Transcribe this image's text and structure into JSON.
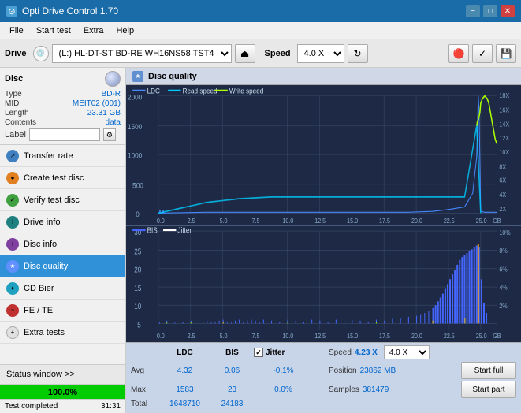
{
  "titlebar": {
    "title": "Opti Drive Control 1.70",
    "icon": "⊙",
    "minimize": "−",
    "maximize": "□",
    "close": "✕"
  },
  "menu": {
    "items": [
      "File",
      "Start test",
      "Extra",
      "Help"
    ]
  },
  "toolbar": {
    "drive_label": "Drive",
    "drive_value": "(L:)  HL-DT-ST BD-RE  WH16NS58 TST4",
    "speed_label": "Speed",
    "speed_value": "4.0 X"
  },
  "sidebar": {
    "disc_title": "Disc",
    "disc_type_label": "Type",
    "disc_type_value": "BD-R",
    "disc_mid_label": "MID",
    "disc_mid_value": "MEIT02 (001)",
    "disc_length_label": "Length",
    "disc_length_value": "23.31 GB",
    "disc_contents_label": "Contents",
    "disc_contents_value": "data",
    "disc_label_label": "Label",
    "nav_items": [
      {
        "id": "transfer-rate",
        "label": "Transfer rate",
        "icon": "↗"
      },
      {
        "id": "create-test-disc",
        "label": "Create test disc",
        "icon": "●"
      },
      {
        "id": "verify-test-disc",
        "label": "Verify test disc",
        "icon": "✓"
      },
      {
        "id": "drive-info",
        "label": "Drive info",
        "icon": "i"
      },
      {
        "id": "disc-info",
        "label": "Disc info",
        "icon": "i"
      },
      {
        "id": "disc-quality",
        "label": "Disc quality",
        "icon": "★",
        "active": true
      },
      {
        "id": "cd-bier",
        "label": "CD Bier",
        "icon": "♦"
      },
      {
        "id": "fe-te",
        "label": "FE / TE",
        "icon": "~"
      },
      {
        "id": "extra-tests",
        "label": "Extra tests",
        "icon": "+"
      }
    ],
    "status_window_label": "Status window >>",
    "progress_percent": "100.0%",
    "status_text": "Test completed",
    "time_value": "31:31"
  },
  "disc_quality": {
    "title": "Disc quality",
    "icon": "★",
    "legend": {
      "ldc_label": "LDC",
      "read_speed_label": "Read speed",
      "write_speed_label": "Write speed",
      "bis_label": "BIS",
      "jitter_label": "Jitter"
    },
    "chart_top": {
      "y_max": 2000,
      "y_labels_left": [
        "2000",
        "1500",
        "1000",
        "500",
        "0"
      ],
      "y_labels_right": [
        "18X",
        "16X",
        "14X",
        "12X",
        "10X",
        "8X",
        "6X",
        "4X",
        "2X"
      ],
      "x_labels": [
        "0.0",
        "2.5",
        "5.0",
        "7.5",
        "10.0",
        "12.5",
        "15.0",
        "17.5",
        "20.0",
        "22.5",
        "25.0"
      ],
      "x_unit": "GB"
    },
    "chart_bottom": {
      "y_labels_left": [
        "30",
        "25",
        "20",
        "15",
        "10",
        "5"
      ],
      "y_labels_right": [
        "10%",
        "8%",
        "6%",
        "4%",
        "2%"
      ],
      "x_labels": [
        "0.0",
        "2.5",
        "5.0",
        "7.5",
        "10.0",
        "12.5",
        "15.0",
        "17.5",
        "20.0",
        "22.5",
        "25.0"
      ],
      "x_unit": "GB"
    },
    "stats": {
      "ldc_label": "LDC",
      "bis_label": "BIS",
      "jitter_label": "Jitter",
      "jitter_checked": true,
      "speed_label": "Speed",
      "speed_value": "4.23 X",
      "speed_select": "4.0 X",
      "position_label": "Position",
      "position_value": "23862 MB",
      "samples_label": "Samples",
      "samples_value": "381479",
      "avg_label": "Avg",
      "avg_ldc": "4.32",
      "avg_bis": "0.06",
      "avg_jitter": "-0.1%",
      "max_label": "Max",
      "max_ldc": "1583",
      "max_bis": "23",
      "max_jitter": "0.0%",
      "total_label": "Total",
      "total_ldc": "1648710",
      "total_bis": "24183",
      "start_full_label": "Start full",
      "start_part_label": "Start part"
    }
  }
}
